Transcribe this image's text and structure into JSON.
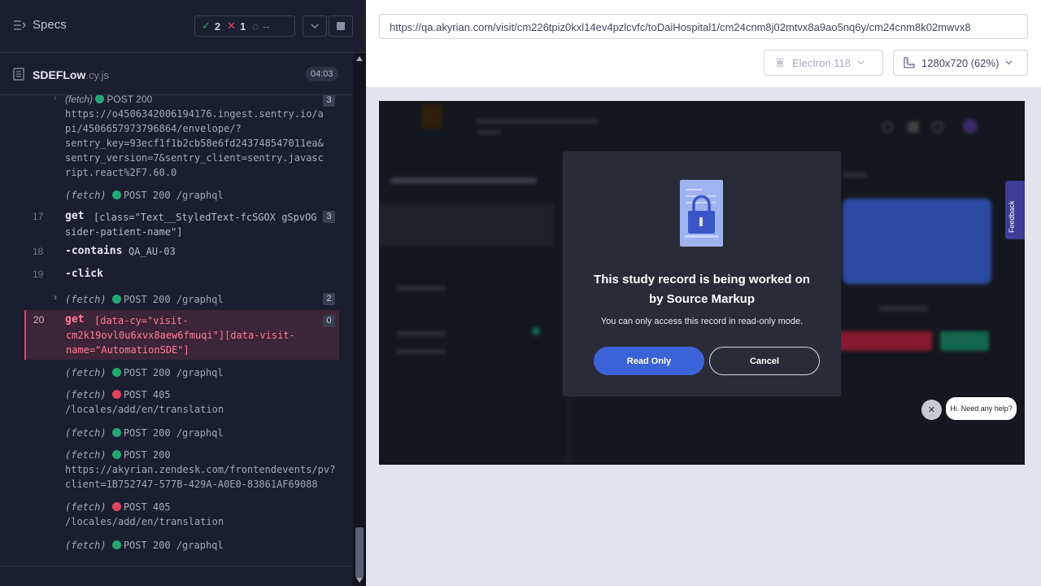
{
  "reporter": {
    "specs_label": "Specs",
    "stats": {
      "passed": "2",
      "failed": "1",
      "pending": "--"
    },
    "spec_file": {
      "name": "SDEFLow",
      "ext": ".cy.js",
      "duration": "04:03"
    }
  },
  "log": {
    "entry0": {
      "label": "(fetch)",
      "status": "POST 200",
      "badge": "3",
      "url": [
        "https://o4506342006194176.ingest.sentry.io/a",
        "pi/4506657973796864/envelope/?",
        "sentry_key=93ecf1f1b2cb58e6fd243748547011ea&",
        "sentry_version=7&sentry_client=sentry.javasc",
        "ript.react%2F7.60.0"
      ]
    },
    "entry1": {
      "label": "(fetch)",
      "status": "POST 200 /graphql"
    },
    "cmd17": {
      "num": "17",
      "name": "get",
      "msg1": "[class=\"Text__StyledText-fcSGOX gSpvOG",
      "msg2": "sider-patient-name\"]",
      "badge": "3"
    },
    "cmd18": {
      "num": "18",
      "name": "-contains",
      "msg": "QA_AU-03"
    },
    "cmd19": {
      "num": "19",
      "name": "-click"
    },
    "entry2": {
      "label": "(fetch)",
      "status": "POST 200 /graphql",
      "badge": "2"
    },
    "cmd20": {
      "num": "20",
      "name": "get",
      "msg1": "[data-cy=\"visit-",
      "msg2": "cm2k19ovl0u6xvx8aew6fmuqi\"][data-visit-",
      "msg3": "name=\"AutomationSDE\"]",
      "badge": "0"
    },
    "entry3": {
      "label": "(fetch)",
      "status": "POST 200 /graphql"
    },
    "entry4": {
      "label": "(fetch)",
      "status": "POST 405",
      "url": "/locales/add/en/translation"
    },
    "entry5": {
      "label": "(fetch)",
      "status": "POST 200 /graphql"
    },
    "entry6": {
      "label": "(fetch)",
      "status": "POST 200",
      "url1": "https://akyrian.zendesk.com/frontendevents/pv?",
      "url2": "client=1B752747-577B-429A-A0E0-83861AF69088"
    },
    "entry7": {
      "label": "(fetch)",
      "status": "POST 405",
      "url": "/locales/add/en/translation"
    },
    "entry8": {
      "label": "(fetch)",
      "status": "POST 200 /graphql"
    }
  },
  "browser": {
    "url": "https://qa.akyrian.com/visit/cm226tpiz0kxl14ev4pzlcvfc/toDaiHospital1/cm24cnm8j02mtvx8a9ao5nq6y/cm24cnm8k02mwvx8",
    "browser_name": "Electron 118",
    "viewport": "1280x720 (62%)"
  },
  "aut": {
    "feedback": "Feedback",
    "dialog": {
      "title_line1": "This study record is being worked on",
      "title_line2": "by Source Markup",
      "text": "You can only access this record in read-only mode.",
      "read_only": "Read Only",
      "cancel": "Cancel"
    },
    "chat_text": "Hi. Need any help?"
  },
  "colors": {
    "pass": "#1fa971",
    "fail": "#e04460",
    "accent_blue": "#3b63d8",
    "highlight_row": "#3c2537"
  }
}
